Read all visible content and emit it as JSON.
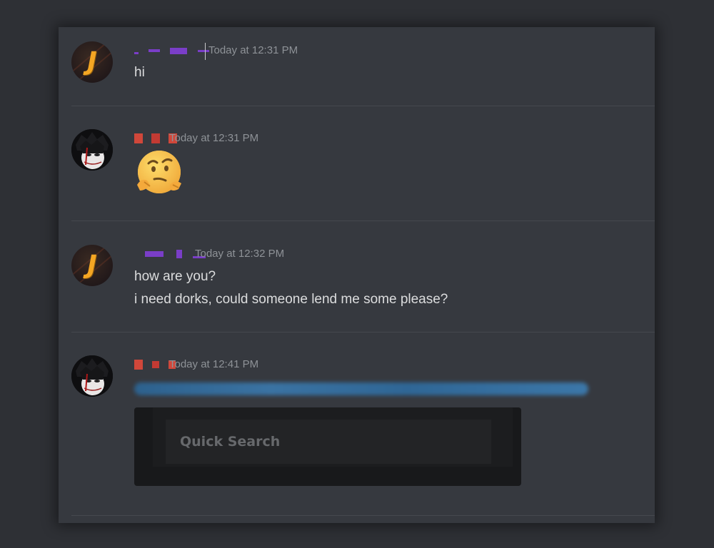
{
  "messages": [
    {
      "id": "m1",
      "author_color": "#7a3ec8",
      "timestamp": "Today at 12:31 PM",
      "lines": [
        "hi"
      ]
    },
    {
      "id": "m2",
      "author_color": "#d0473a",
      "timestamp": "Today at 12:31 PM",
      "emoji": "thinking-face-pointing"
    },
    {
      "id": "m3",
      "author_color": "#7a3ec8",
      "timestamp": "Today at 12:32 PM",
      "lines": [
        "how are you?",
        "i need dorks, could someone lend me some please?"
      ]
    },
    {
      "id": "m4",
      "author_color": "#d0473a",
      "timestamp": "Today at 12:41 PM",
      "link_color": "#3a86c8",
      "embed": {
        "search_placeholder": "Quick Search"
      }
    }
  ],
  "colors": {
    "background": "#2e3035",
    "chat_bg": "#36393f",
    "text": "#dcddde",
    "timestamp": "#8e9297",
    "divider": "#45484e"
  },
  "icons": {
    "avatar_1": "j-logo-avatar",
    "avatar_2": "masked-face-avatar",
    "emoji": "thinking-emoji"
  }
}
